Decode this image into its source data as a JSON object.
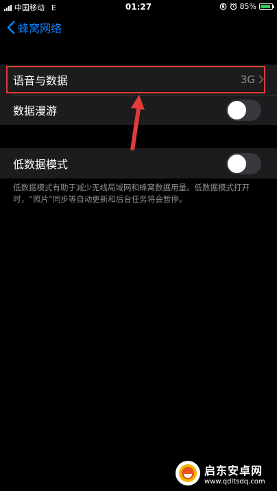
{
  "status_bar": {
    "carrier": "中国移动",
    "network": "E",
    "time": "01:27",
    "battery": "85%",
    "battery_level": 0.85
  },
  "nav": {
    "back_label": "蜂窝网络"
  },
  "group1": {
    "voice_data_label": "语音与数据",
    "voice_data_value": "3G",
    "roaming_label": "数据漫游",
    "roaming_on": false
  },
  "group2": {
    "low_data_label": "低数据模式",
    "low_data_on": false
  },
  "footnote": "低数据模式有助于减少无线局域网和蜂窝数据用量。低数据模式打开时，“照片”同步等自动更新和后台任务将会暂停。",
  "watermark": {
    "name": "启东安卓网",
    "url": "www.qdltsdq.com"
  },
  "colors": {
    "accent": "#0a84ff",
    "highlight": "#e23a3a",
    "battery": "#34c759"
  }
}
